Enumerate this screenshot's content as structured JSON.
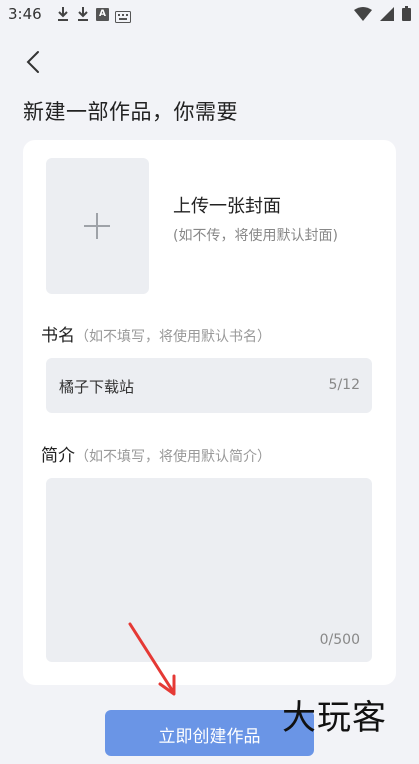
{
  "status_bar": {
    "time": "3:46",
    "a_badge": "A"
  },
  "header": {
    "title": "新建一部作品，你需要"
  },
  "cover": {
    "title": "上传一张封面",
    "subtitle": "(如不传，将使用默认封面)"
  },
  "name_field": {
    "label": "书名",
    "hint": "（如不填写，将使用默认书名）",
    "value": "橘子下载站",
    "count": "5/12"
  },
  "intro_field": {
    "label": "简介",
    "hint": "（如不填写，将使用默认简介）",
    "value": "",
    "count": "0/500"
  },
  "actions": {
    "create_label": "立即创建作品"
  },
  "watermark": {
    "text": "大玩客"
  },
  "colors": {
    "accent": "#6a95e6",
    "annotation": "#e53935"
  }
}
